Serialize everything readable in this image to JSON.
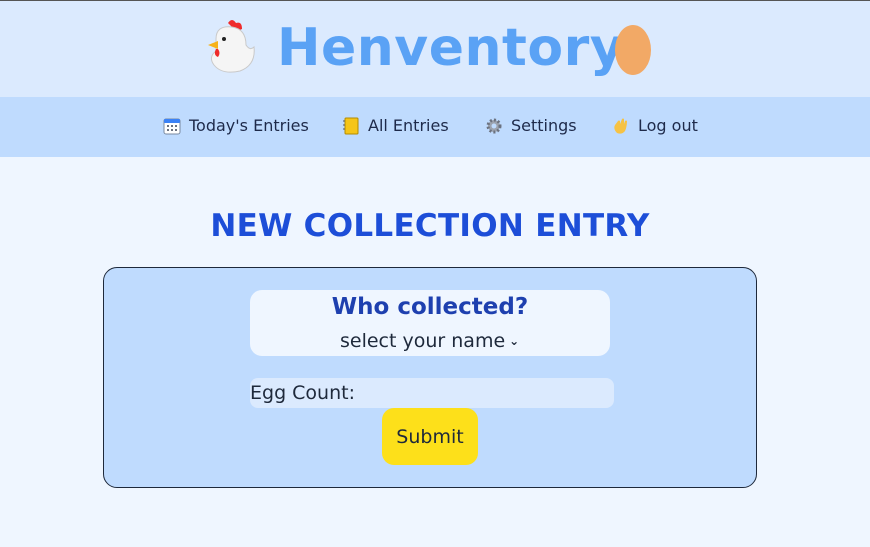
{
  "header": {
    "title": "Henventory",
    "left_icon": "chicken-icon",
    "right_icon": "egg-icon"
  },
  "nav": {
    "items": [
      {
        "label": "Today's Entries",
        "icon": "calendar-icon"
      },
      {
        "label": "All Entries",
        "icon": "notebook-icon"
      },
      {
        "label": "Settings",
        "icon": "gear-icon"
      },
      {
        "label": "Log out",
        "icon": "waving-hand-icon"
      }
    ]
  },
  "page": {
    "title": "NEW COLLECTION ENTRY"
  },
  "form": {
    "who_title": "Who collected?",
    "who_selected": "select your name",
    "egg_count_label": "Egg Count:",
    "egg_count_value": "",
    "submit_label": "Submit"
  },
  "colors": {
    "accent": "#1d4ed8",
    "title": "#5aa2f5",
    "button": "#fde01a",
    "card": "#bfdbfe"
  }
}
